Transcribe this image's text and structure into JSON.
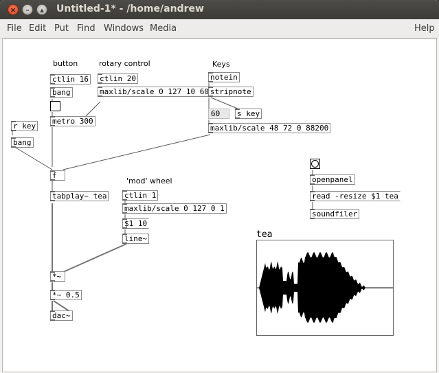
{
  "window": {
    "title": "Untitled-1* - /home/andrew"
  },
  "menubar": {
    "items": [
      "File",
      "Edit",
      "Put",
      "Find",
      "Windows",
      "Media"
    ],
    "help": "Help"
  },
  "comments": {
    "button": "button",
    "rotary": "rotary control",
    "keys": "Keys",
    "mod_wheel": "'mod' wheel",
    "array_name": "tea"
  },
  "objects": {
    "ctlin16": "ctlin 16",
    "bang1": "bang",
    "metro": "metro 300",
    "ctlin20": "ctlin 20",
    "scale_rotary": "maxlib/scale 0 127 10 600",
    "notein": "notein",
    "stripnote": "stripnote",
    "number60": "60",
    "skey": "s key",
    "scale_keys": "maxlib/scale 48 72 0 88200",
    "rkey": "r key",
    "bang2": "bang",
    "f": "f",
    "tabplay": "tabplay~ tea",
    "ctlin1": "ctlin 1",
    "scale_mod": "maxlib/scale 0 127 0 1",
    "msg_line": "$1 10",
    "line": "line~",
    "mul1": "*~",
    "mul2": "*~ 0.5",
    "dac": "dac~",
    "openpanel": "openpanel",
    "read_msg": "read -resize $1 tea",
    "soundfiler": "soundfiler"
  }
}
